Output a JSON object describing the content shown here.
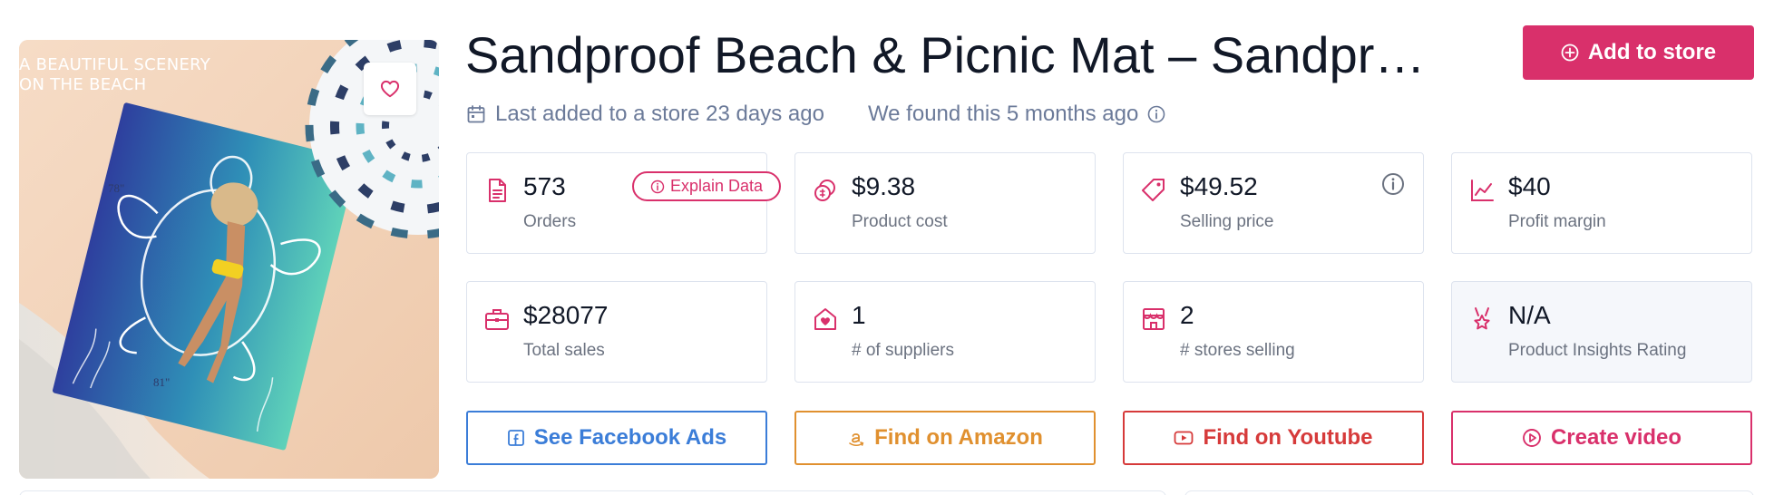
{
  "product": {
    "image_caption_line1": "A BEAUTIFUL SCENERY",
    "image_caption_line2": "ON THE BEACH",
    "dim_width": "78\"",
    "dim_height": "81\"",
    "title": "Sandproof Beach & Picnic Mat – Sandproof Beach & Picnic Mat",
    "favorite_icon": "heart-icon"
  },
  "header": {
    "add_to_store_label": "Add to store",
    "add_icon": "plus-circle-icon"
  },
  "meta": {
    "last_added": "Last added to a store 23 days ago",
    "found": "We found this 5 months ago",
    "calendar_icon": "calendar-icon",
    "info_icon": "info-icon"
  },
  "explain_data_label": "Explain Data",
  "stats": [
    {
      "value": "573",
      "label": "Orders",
      "icon": "document-icon"
    },
    {
      "value": "$9.38",
      "label": "Product cost",
      "icon": "coins-icon"
    },
    {
      "value": "$49.52",
      "label": "Selling price",
      "icon": "tag-icon"
    },
    {
      "value": "$40",
      "label": "Profit margin",
      "icon": "chart-line-icon"
    },
    {
      "value": "$28077",
      "label": "Total sales",
      "icon": "briefcase-icon"
    },
    {
      "value": "1",
      "label": "# of suppliers",
      "icon": "house-heart-icon"
    },
    {
      "value": "2",
      "label": "# stores selling",
      "icon": "store-icon"
    },
    {
      "value": "N/A",
      "label": "Product Insights Rating",
      "icon": "award-icon"
    }
  ],
  "actions": [
    {
      "label": "See Facebook Ads",
      "icon": "facebook-icon",
      "color": "#3b7dd8"
    },
    {
      "label": "Find on Amazon",
      "icon": "amazon-icon",
      "color": "#e0902f"
    },
    {
      "label": "Find on Youtube",
      "icon": "youtube-icon",
      "color": "#d63a3a"
    },
    {
      "label": "Create video",
      "icon": "play-circle-icon",
      "color": "#d9306b"
    }
  ],
  "colors": {
    "accent": "#d9306b",
    "muted_text": "#6b7a99",
    "card_border": "#dde3ee"
  }
}
